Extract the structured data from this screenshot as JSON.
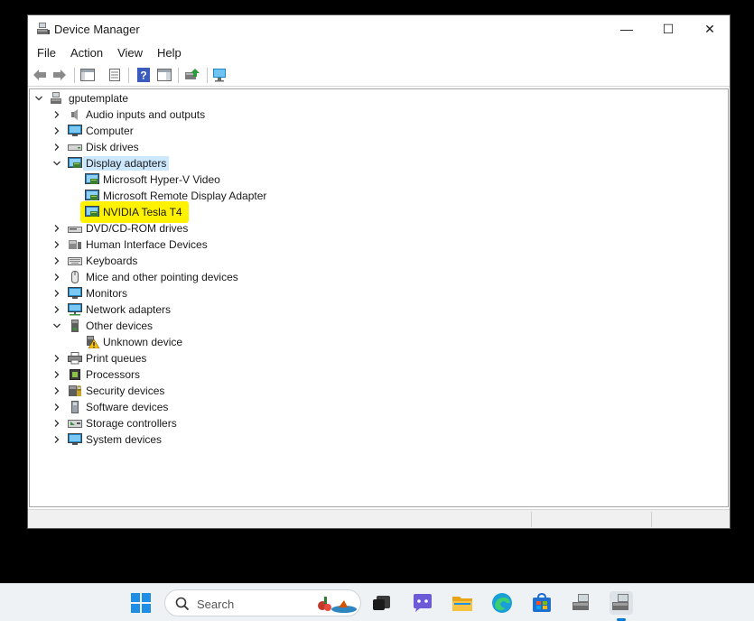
{
  "window": {
    "title": "Device Manager",
    "minimize_glyph": "—",
    "maximize_glyph": "☐",
    "close_glyph": "✕"
  },
  "menu": [
    "File",
    "Action",
    "View",
    "Help"
  ],
  "toolbar": {
    "icons": [
      "back-arrow-icon",
      "forward-arrow-icon",
      "show-hide-console-tree-icon",
      "properties-icon",
      "help-icon",
      "action-pane-icon",
      "update-driver-icon",
      "scan-hardware-icon"
    ]
  },
  "tree": {
    "root": "gputemplate",
    "nodes": [
      {
        "label": "Audio inputs and outputs",
        "icon": "audio-icon",
        "expanded": false
      },
      {
        "label": "Computer",
        "icon": "computer-icon",
        "expanded": false
      },
      {
        "label": "Disk drives",
        "icon": "disk-drive-icon",
        "expanded": false
      },
      {
        "label": "Display adapters",
        "icon": "display-adapter-icon",
        "expanded": true,
        "selected": true,
        "children": [
          {
            "label": "Microsoft Hyper-V Video",
            "icon": "display-adapter-icon"
          },
          {
            "label": "Microsoft Remote Display Adapter",
            "icon": "display-adapter-icon"
          },
          {
            "label": "NVIDIA Tesla T4",
            "icon": "display-adapter-icon",
            "highlighted": true
          }
        ]
      },
      {
        "label": "DVD/CD-ROM drives",
        "icon": "dvd-drive-icon",
        "expanded": false
      },
      {
        "label": "Human Interface Devices",
        "icon": "hid-icon",
        "expanded": false
      },
      {
        "label": "Keyboards",
        "icon": "keyboard-icon",
        "expanded": false
      },
      {
        "label": "Mice and other pointing devices",
        "icon": "mouse-icon",
        "expanded": false
      },
      {
        "label": "Monitors",
        "icon": "monitor-icon",
        "expanded": false
      },
      {
        "label": "Network adapters",
        "icon": "network-adapter-icon",
        "expanded": false
      },
      {
        "label": "Other devices",
        "icon": "other-devices-icon",
        "expanded": true,
        "children": [
          {
            "label": "Unknown device",
            "icon": "unknown-device-warning-icon"
          }
        ]
      },
      {
        "label": "Print queues",
        "icon": "printer-icon",
        "expanded": false
      },
      {
        "label": "Processors",
        "icon": "processor-icon",
        "expanded": false
      },
      {
        "label": "Security devices",
        "icon": "security-device-icon",
        "expanded": false
      },
      {
        "label": "Software devices",
        "icon": "software-device-icon",
        "expanded": false
      },
      {
        "label": "Storage controllers",
        "icon": "storage-controller-icon",
        "expanded": false
      },
      {
        "label": "System devices",
        "icon": "system-devices-icon",
        "expanded": false
      }
    ]
  },
  "taskbar": {
    "search_placeholder": "Search",
    "apps": [
      "start-icon",
      "task-view-icon",
      "chat-icon",
      "file-explorer-icon",
      "edge-icon",
      "store-icon",
      "device-manager-icon",
      "device-manager-active-icon"
    ]
  },
  "colors": {
    "selection": "#cce8ff",
    "highlight": "#fff200",
    "accent": "#0078d4"
  }
}
